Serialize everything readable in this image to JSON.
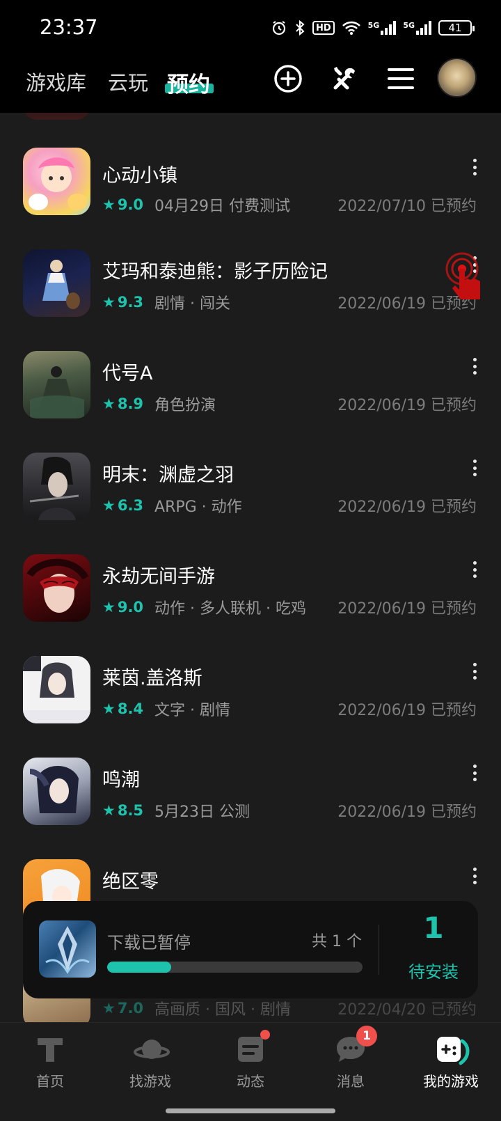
{
  "status_bar": {
    "time": "23:37",
    "network_label_1": "5G",
    "network_label_2": "5G",
    "hd_label": "HD",
    "battery": "41"
  },
  "top_nav": {
    "tabs": [
      {
        "label": "游戏库"
      },
      {
        "label": "云玩"
      },
      {
        "label": "预约"
      }
    ],
    "active_tab": "预约",
    "icons": [
      "plus-circle-icon",
      "tools-icon",
      "menu-icon",
      "avatar"
    ]
  },
  "games": [
    {
      "title": "心动小镇",
      "rating": "9.0",
      "tags": "04月29日 付费测试",
      "date": "2022/07/10 已预约",
      "icon_colors": [
        "#f6a0c2",
        "#f7d75a"
      ]
    },
    {
      "title": "艾玛和泰迪熊：影子历险记",
      "rating": "9.3",
      "tags": "剧情 · 闯关",
      "date": "2022/06/19 已预约",
      "icon_colors": [
        "#1b1f3a",
        "#5b7bbf"
      ]
    },
    {
      "title": "代号A",
      "rating": "8.9",
      "tags": "角色扮演",
      "date": "2022/06/19 已预约",
      "icon_colors": [
        "#2f3a2a",
        "#8d8a63"
      ]
    },
    {
      "title": "明末：渊虚之羽",
      "rating": "6.3",
      "tags": "ARPG · 动作",
      "date": "2022/06/19 已预约",
      "icon_colors": [
        "#2a2a2e",
        "#6f6a66"
      ]
    },
    {
      "title": "永劫无间手游",
      "rating": "9.0",
      "tags": "动作 · 多人联机 · 吃鸡",
      "date": "2022/06/19 已预约",
      "icon_colors": [
        "#6b0f14",
        "#e8c6b8"
      ]
    },
    {
      "title": "莱茵.盖洛斯",
      "rating": "8.4",
      "tags": "文字 · 剧情",
      "date": "2022/06/19 已预约",
      "icon_colors": [
        "#f2f2f2",
        "#3b3b55"
      ]
    },
    {
      "title": "鸣潮",
      "rating": "8.5",
      "tags": "5月23日 公测",
      "date": "2022/06/19 已预约",
      "icon_colors": [
        "#dfe3ea",
        "#2c2f45"
      ]
    },
    {
      "title": "绝区零",
      "rating": "",
      "tags": "",
      "date": "",
      "icon_colors": [
        "#f29a2e",
        "#ffffff"
      ]
    },
    {
      "title": "",
      "rating": "7.0",
      "tags": "高画质 · 国风 · 剧情",
      "date": "2022/04/20 已预约",
      "icon_colors": [
        "#d8c39a",
        "#8a6a4a"
      ]
    }
  ],
  "download": {
    "status": "下载已暂停",
    "count": "共 1 个",
    "progress": 0.25,
    "pending_count": "1",
    "pending_label": "待安装"
  },
  "bottom_nav": {
    "items": [
      {
        "label": "首页",
        "icon": "home-t-icon"
      },
      {
        "label": "找游戏",
        "icon": "planet-icon"
      },
      {
        "label": "动态",
        "icon": "feed-icon"
      },
      {
        "label": "消息",
        "icon": "chat-icon",
        "badge": "1"
      },
      {
        "label": "我的游戏",
        "icon": "gamepad-icon"
      }
    ]
  },
  "colors": {
    "accent": "#1ec3ad",
    "background": "#1c1c1c",
    "badge": "#f0504c"
  }
}
